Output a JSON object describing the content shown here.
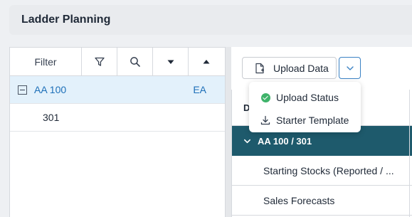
{
  "header": {
    "title": "Ladder Planning"
  },
  "left_panel": {
    "filter_label": "Filter",
    "tree": [
      {
        "label": "AA 100",
        "code": "EA",
        "expanded": true,
        "selected": true
      },
      {
        "label": "301"
      }
    ]
  },
  "toolbar": {
    "upload_label": "Upload Data"
  },
  "menu": {
    "items": [
      {
        "label": "Upload Status",
        "icon": "check-circle-icon"
      },
      {
        "label": "Starter Template",
        "icon": "download-icon"
      }
    ]
  },
  "grid": {
    "header_label": "D",
    "group": {
      "label": "AA 100 / 301"
    },
    "rows": [
      {
        "label": "Starting Stocks (Reported / ..."
      },
      {
        "label": "Sales Forecasts"
      }
    ]
  },
  "colors": {
    "accent": "#1d6fb8",
    "group_bg": "#1e5a6c",
    "selected_row": "#e3f1fb",
    "success": "#3fb36a"
  }
}
